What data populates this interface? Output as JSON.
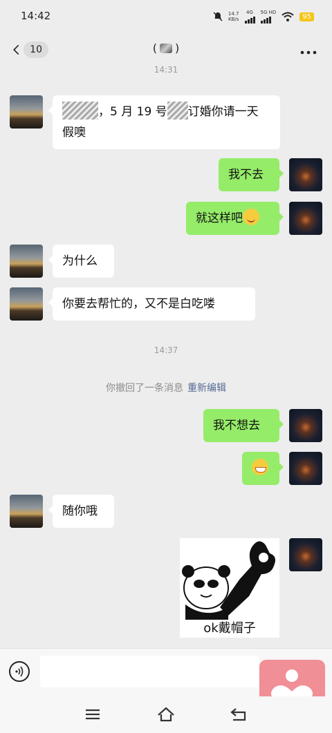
{
  "status_bar": {
    "time": "14:42",
    "net_speed": "14.7",
    "net_unit": "KB/s",
    "net_4g": "4G",
    "net_5g": "5G HD",
    "battery": "95"
  },
  "header": {
    "unread_count": "10",
    "title_left": "(",
    "title_right": ")"
  },
  "messages": [
    {
      "side": "ts",
      "text": "14:31"
    },
    {
      "side": "left",
      "parts": [
        "，5 月 19 号",
        "订婚你请一天",
        "假噢"
      ]
    },
    {
      "side": "right",
      "text": "我不去"
    },
    {
      "side": "right",
      "text": "就这样吧"
    },
    {
      "side": "left",
      "text": "为什么"
    },
    {
      "side": "left",
      "text": "你要去帮忙的，又不是白吃喽"
    },
    {
      "side": "ts",
      "text": "14:37"
    },
    {
      "side": "notice",
      "text": "你撤回了一条消息",
      "link": "重新编辑"
    },
    {
      "side": "right",
      "text": "我不想去"
    },
    {
      "side": "left",
      "text": "随你哦"
    },
    {
      "side": "right",
      "sticker_caption": "ok戴帽子"
    }
  ],
  "icons": {
    "back": "chevron-left-icon",
    "more": "more-dots-icon",
    "voice": "voice-icon",
    "float": "heart-icon"
  },
  "colors": {
    "background": "#ededed",
    "bubble_self": "#95ec69",
    "bubble_other": "#ffffff",
    "link": "#576b95",
    "float_button": "#f08f96",
    "battery": "#f5c518"
  }
}
